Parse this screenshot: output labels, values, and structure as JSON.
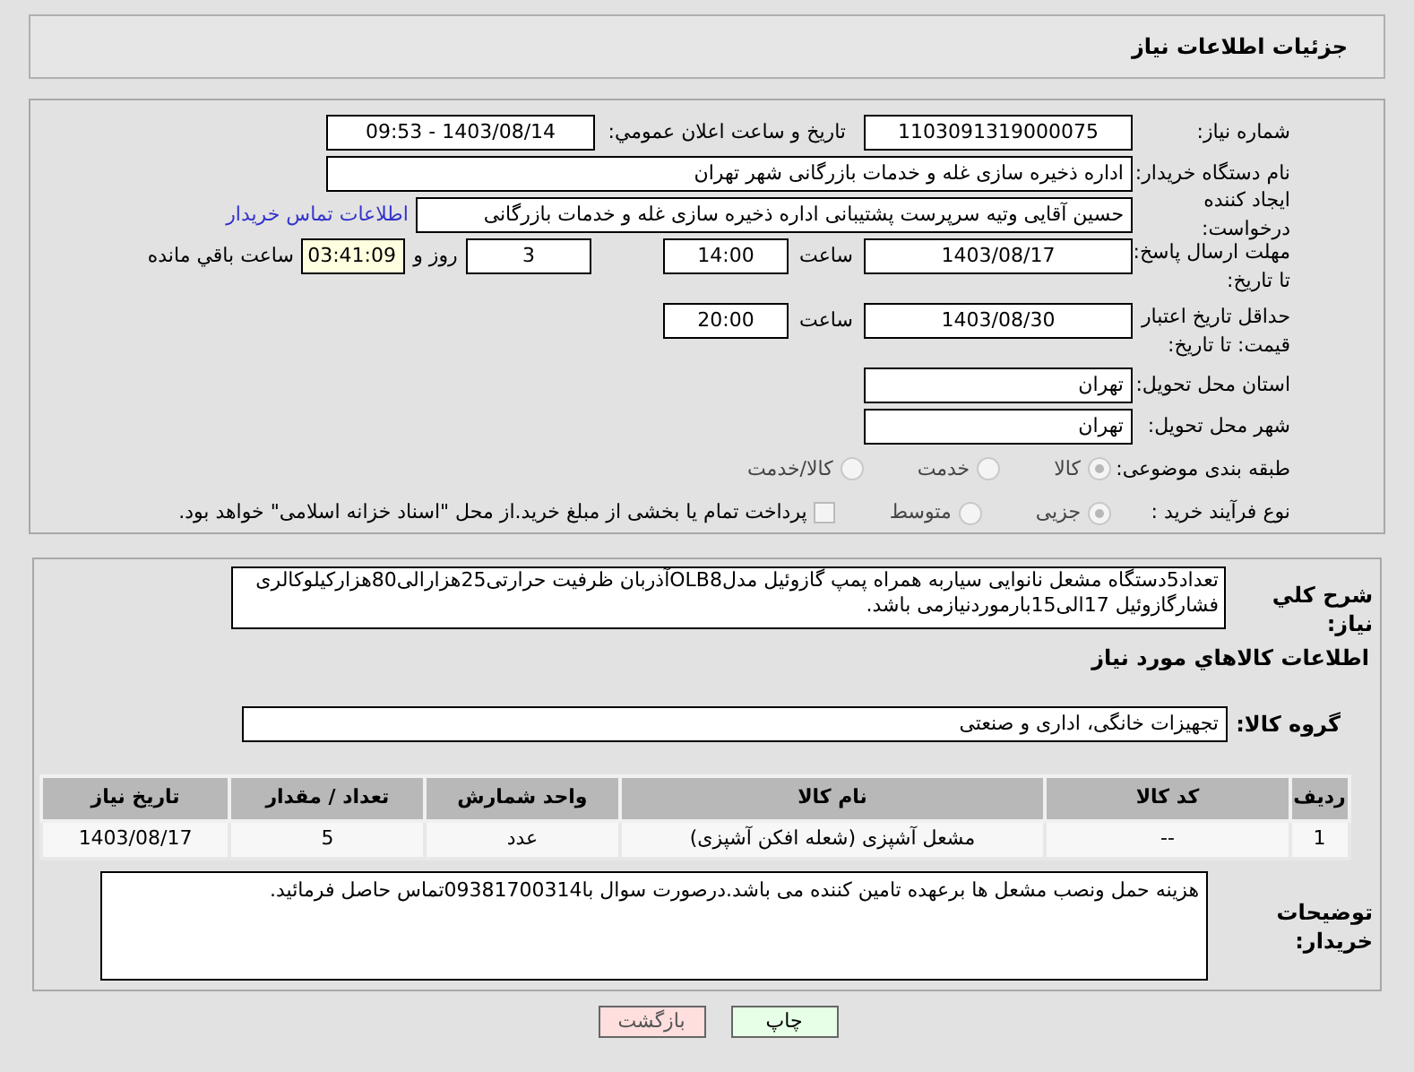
{
  "header": {
    "title": "جزئیات اطلاعات نیاز"
  },
  "need_number": {
    "label": "شماره نیاز:",
    "value": "1103091319000075"
  },
  "announce": {
    "label": "تاریخ و ساعت اعلان عمومي:",
    "value": "1403/08/14 - 09:53"
  },
  "buyer_org": {
    "label": "نام دستگاه خریدار:",
    "value": "اداره ذخیره سازی غله و خدمات بازرگانی شهر تهران"
  },
  "requester": {
    "label": "ایجاد کننده درخواست:",
    "value": "حسین آقایی وتیه سرپرست پشتیبانی اداره ذخیره سازی غله و خدمات بازرگانی",
    "link": "اطلاعات تماس خریدار"
  },
  "reply_deadline": {
    "label": "مهلت ارسال پاسخ: تا تاریخ:",
    "date": "1403/08/17",
    "time_label": "ساعت",
    "time": "14:00",
    "days": "3",
    "days_label": "روز و",
    "remaining": "03:41:09",
    "remaining_label": "ساعت باقي مانده"
  },
  "price_validity": {
    "label": "حداقل تاریخ اعتبار قیمت: تا تاریخ:",
    "date": "1403/08/30",
    "time_label": "ساعت",
    "time": "20:00"
  },
  "province": {
    "label": "استان محل تحویل:",
    "value": "تهران"
  },
  "city": {
    "label": "شهر محل تحویل:",
    "value": "تهران"
  },
  "category": {
    "label": "طبقه بندی موضوعی:",
    "options": [
      {
        "label": "کالا",
        "selected": true
      },
      {
        "label": "خدمت",
        "selected": false
      },
      {
        "label": "کالا/خدمت",
        "selected": false
      }
    ]
  },
  "process": {
    "label": "نوع فرآیند خرید :",
    "options": [
      {
        "label": "جزیی",
        "selected": true
      },
      {
        "label": "متوسط",
        "selected": false
      }
    ],
    "checkbox": {
      "label": "پرداخت تمام یا بخشی از مبلغ خرید.از محل \"اسناد خزانه اسلامی\" خواهد بود.",
      "checked": false
    }
  },
  "description": {
    "label": "شرح کلي نیاز:",
    "value": "تعداد5دستگاه مشعل نانوایی سیاربه همراه پمپ گازوئیل مدلOLB8آذربان ظرفیت حرارتی25هزارالی80هزارکیلوکالری فشارگازوئیل 17الی15بارموردنیازمی باشد."
  },
  "goods_title": "اطلاعات کالاهاي مورد نیاز",
  "goods_group": {
    "label": "گروه کالا:",
    "value": "تجهیزات خانگی، اداری و صنعتی"
  },
  "table": {
    "columns": [
      "ردیف",
      "کد کالا",
      "نام کالا",
      "واحد شمارش",
      "تعداد / مقدار",
      "تاریخ نیاز"
    ],
    "rows": [
      [
        "1",
        "--",
        "مشعل آشپزی (شعله افکن آشپزی)",
        "عدد",
        "5",
        "1403/08/17"
      ]
    ]
  },
  "buyer_notes": {
    "label": "توضیحات خریدار:",
    "value": "هزینه حمل ونصب مشعل ها برعهده تامین کننده می باشد.درصورت سوال با09381700314تماس حاصل فرمائید."
  },
  "buttons": [
    {
      "label": "چاپ",
      "kind": "print"
    },
    {
      "label": "بازگشت",
      "kind": "back"
    }
  ]
}
